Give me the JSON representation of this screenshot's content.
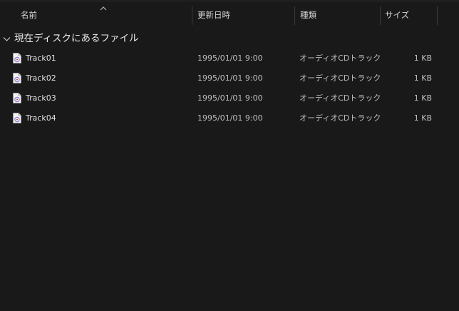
{
  "columns": {
    "name": "名前",
    "date": "更新日時",
    "type": "種類",
    "size": "サイズ"
  },
  "group": {
    "label": "現在ディスクにあるファイル"
  },
  "files": [
    {
      "name": "Track01",
      "date": "1995/01/01 9:00",
      "type": "オーディオCDトラック",
      "size": "1 KB"
    },
    {
      "name": "Track02",
      "date": "1995/01/01 9:00",
      "type": "オーディオCDトラック",
      "size": "1 KB"
    },
    {
      "name": "Track03",
      "date": "1995/01/01 9:00",
      "type": "オーディオCDトラック",
      "size": "1 KB"
    },
    {
      "name": "Track04",
      "date": "1995/01/01 9:00",
      "type": "オーディオCDトラック",
      "size": "1 KB"
    }
  ],
  "colors": {
    "background": "#191919",
    "text": "#e0e0e0",
    "separator": "#3a3a3a",
    "icon_accent": "#7d6bd6"
  },
  "icons": {
    "sort": "sort-ascending-icon",
    "group_toggle": "chevron-down-icon",
    "file": "cd-audio-track-file-icon"
  }
}
